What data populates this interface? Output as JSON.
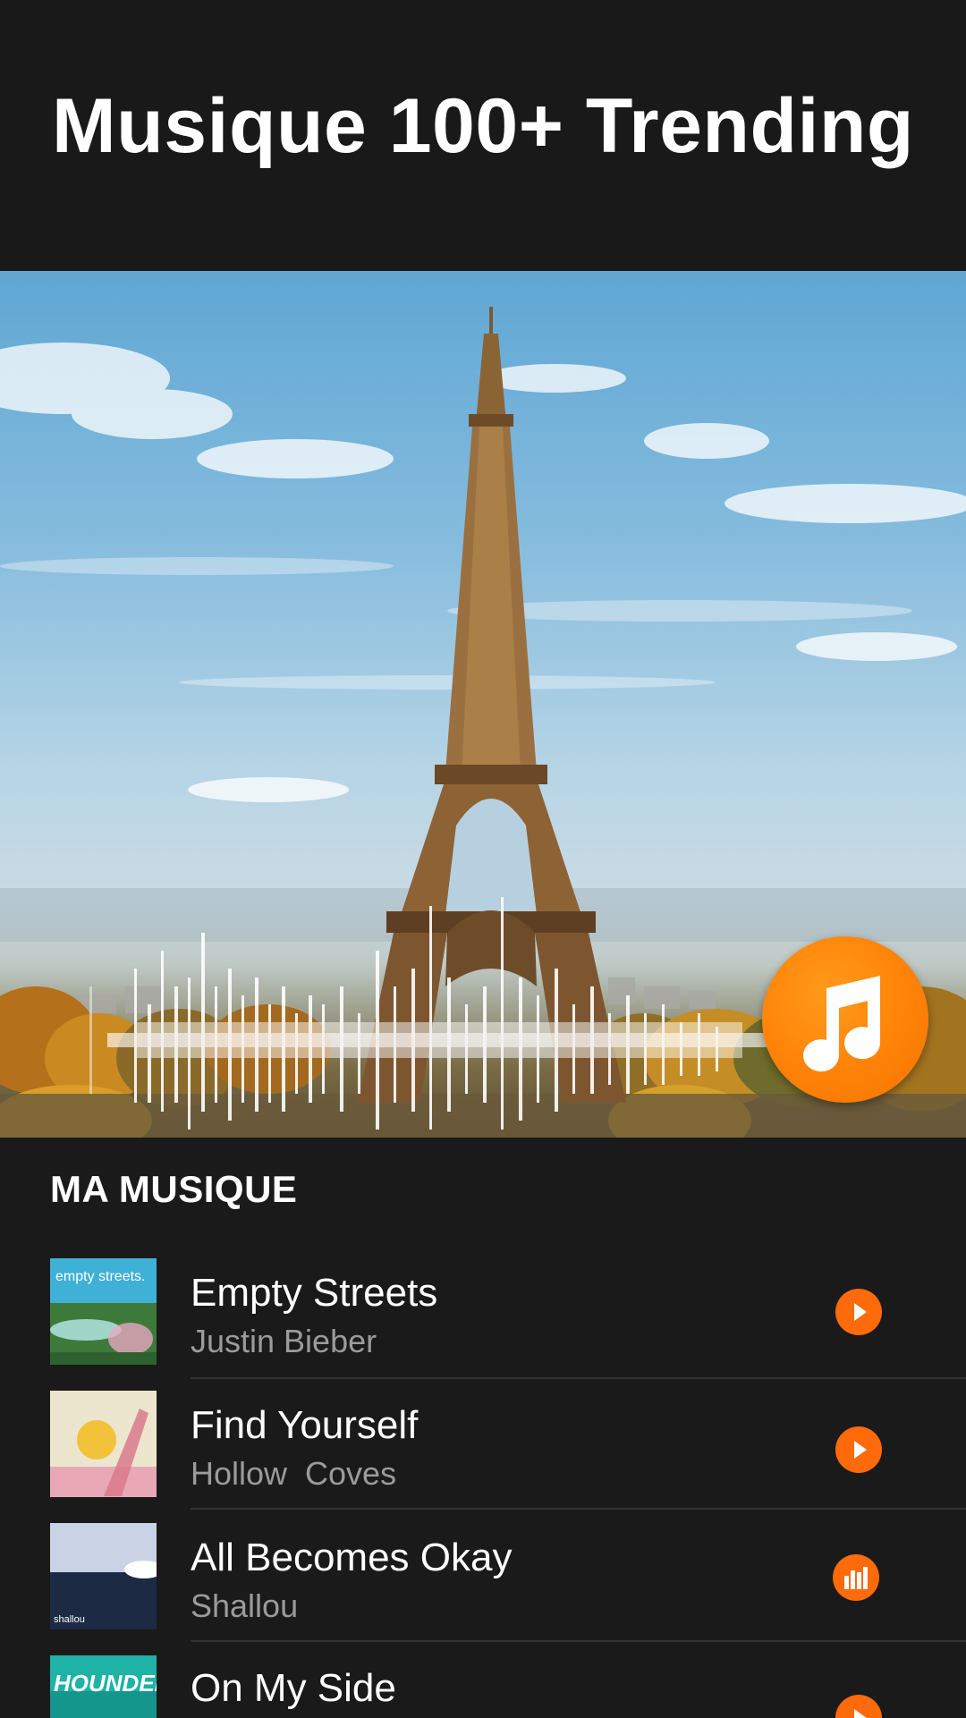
{
  "header": {
    "title": "Musique 100+ Trending"
  },
  "hero": {
    "image": "eiffel-tower-photo",
    "overlay": "audio-waveform"
  },
  "fab": {
    "icon": "music-note-icon",
    "color": "#ff8208"
  },
  "section": {
    "title": "MA MUSIQUE"
  },
  "tracks": [
    {
      "title": "Empty Streets",
      "artist": "Justin Bieber",
      "cover_text": "empty streets.",
      "action_icon": "play-icon"
    },
    {
      "title": "Find Yourself",
      "artist": "Hollow  Coves",
      "action_icon": "play-icon"
    },
    {
      "title": "All Becomes Okay",
      "artist": "Shallou",
      "cover_text": "shallou",
      "action_icon": "equalizer-icon"
    },
    {
      "title": "On My Side",
      "artist": "",
      "cover_text": "HOUNDED",
      "action_icon": "play-icon"
    }
  ],
  "colors": {
    "accent": "#ff6a0a",
    "background": "#1a1a1a",
    "secondary_text": "#9b9b9b"
  }
}
